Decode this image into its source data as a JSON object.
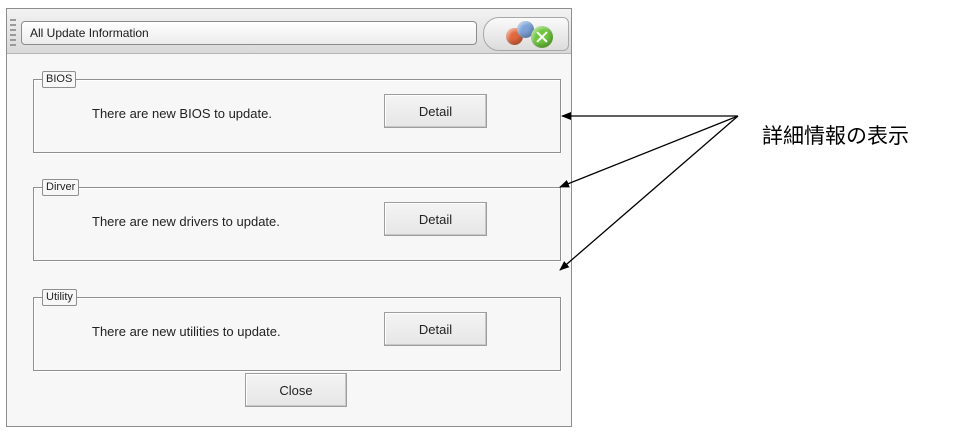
{
  "window": {
    "title": "All Update Information"
  },
  "groups": [
    {
      "label": "BIOS",
      "message": "There are new BIOS to update.",
      "button_label": "Detail"
    },
    {
      "label": "Dirver",
      "message": "There are new drivers to update.",
      "button_label": "Detail"
    },
    {
      "label": "Utility",
      "message": "There are new utilities to update.",
      "button_label": "Detail"
    }
  ],
  "footer": {
    "close_label": "Close"
  },
  "annotation": {
    "text": "詳細情報の表示"
  },
  "icons": {
    "window_controls": [
      "minimize-orange-icon",
      "restore-blue-icon",
      "close-green-icon"
    ]
  },
  "colors": {
    "close_control": "#6fc63d",
    "minimize_control": "#e2683f",
    "restore_control": "#7ea3d8"
  }
}
